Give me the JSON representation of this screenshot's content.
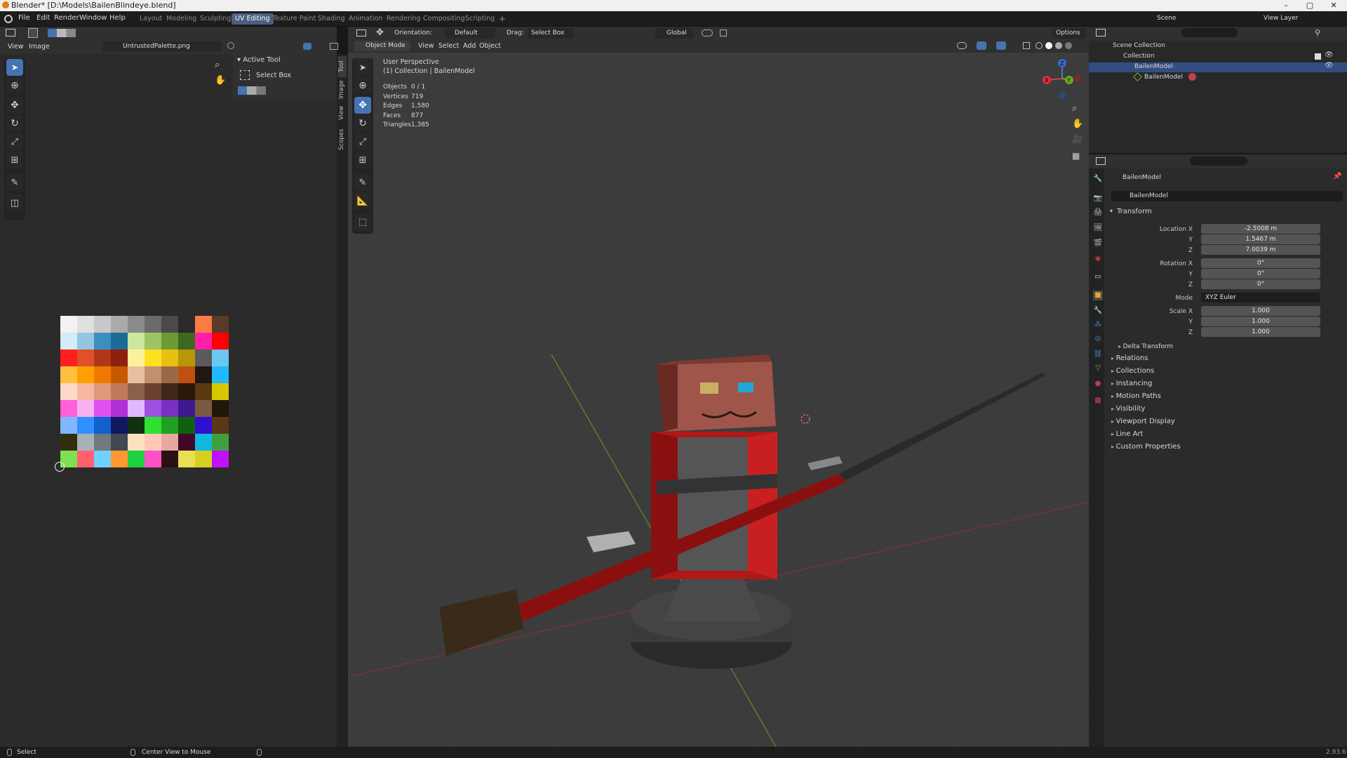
{
  "window": {
    "title": "Blender* [D:\\Models\\BailenBlindeye.blend]",
    "minimize": "–",
    "maximize": "▢",
    "close": "✕"
  },
  "menu": [
    "File",
    "Edit",
    "Render",
    "Window",
    "Help"
  ],
  "workspaces": [
    "Layout",
    "Modeling",
    "Sculpting",
    "UV Editing",
    "Texture Paint",
    "Shading",
    "Animation",
    "Rendering",
    "Compositing",
    "Scripting"
  ],
  "workspace_add": "+",
  "active_workspace": "UV Editing",
  "scene": {
    "label": "Scene",
    "view_layer": "View Layer"
  },
  "image_editor": {
    "menu_view": "View",
    "menu_image": "Image",
    "image_name": "UntrustedPalette.png",
    "tabs": [
      "Tool",
      "Image",
      "View",
      "Scopes"
    ],
    "active_tool_header": "Active Tool",
    "active_tool": "Select Box"
  },
  "palette": [
    "#f2f2f2",
    "#e0e0e0",
    "#c8c8c8",
    "#aaaaaa",
    "#8a8a8a",
    "#6a6a6a",
    "#4a4a4a",
    "#2a2a2a",
    "#ff7b45",
    "#5a3a2a",
    "#d2ecf8",
    "#94c6e0",
    "#3a8fbf",
    "#1e6a96",
    "#cde6a0",
    "#9cc466",
    "#6e9a36",
    "#3d6820",
    "#ff1fa8",
    "#ff0000",
    "#ff1f1f",
    "#e0502a",
    "#b03818",
    "#8e2010",
    "#fff19a",
    "#ffe020",
    "#e8c010",
    "#b8960a",
    "#5a5a5a",
    "#6cc8f0",
    "#ffc040",
    "#ffa000",
    "#f07800",
    "#c85800",
    "#e8c0a0",
    "#c09070",
    "#9a6a48",
    "#c05010",
    "#201810",
    "#20b8ff",
    "#ffd8c8",
    "#f8b8a0",
    "#e09878",
    "#c07a5a",
    "#8a6048",
    "#6a4030",
    "#402818",
    "#2a1808",
    "#5a3a10",
    "#d8c800",
    "#ff60d8",
    "#f8b0f0",
    "#e050f0",
    "#b030d8",
    "#e0b8ff",
    "#a050e0",
    "#7a30c0",
    "#401890",
    "#7a5a40",
    "#201808",
    "#80b8ff",
    "#3090ff",
    "#1060d0",
    "#101860",
    "#103010",
    "#30e030",
    "#20a020",
    "#106010",
    "#3010d0",
    "#5a3818",
    "#303010",
    "#a8b0b8",
    "#707880",
    "#404850",
    "#ffe0c0",
    "#ffc8b8",
    "#e8a8a0",
    "#400828",
    "#10b8e0",
    "#40a040",
    "#80e050",
    "#ff6070",
    "#70d0ff",
    "#ff9830",
    "#20d040",
    "#ff50c8",
    "#2a1010",
    "#e8e050",
    "#d8d020",
    "#c010ff"
  ],
  "viewport": {
    "mode": "Object Mode",
    "menus": [
      "View",
      "Select",
      "Add",
      "Object"
    ],
    "orientation_label": "Orientation:",
    "orientation": "Default",
    "drag_label": "Drag:",
    "drag": "Select Box",
    "transform": "Global",
    "options": "Options",
    "perspective": "User Perspective",
    "collection_line": "(1) Collection | BailenModel",
    "stats": [
      {
        "k": "Objects",
        "v": "0 / 1"
      },
      {
        "k": "Vertices",
        "v": "719"
      },
      {
        "k": "Edges",
        "v": "1,580"
      },
      {
        "k": "Faces",
        "v": "877"
      },
      {
        "k": "Triangles",
        "v": "1,385"
      }
    ],
    "gizmo": {
      "x": "X",
      "y": "Y",
      "z": "Z"
    }
  },
  "outliner": {
    "scene_collection": "Scene Collection",
    "collection": "Collection",
    "object": "BailenModel",
    "mesh": "BailenModel"
  },
  "properties": {
    "object_name": "BailenModel",
    "datablock": "BailenModel",
    "transform": "Transform",
    "location": {
      "label": "Location X",
      "x": "-2.5008 m",
      "y": "1.5467 m",
      "z": "7.0039 m"
    },
    "rotation": {
      "label": "Rotation X",
      "x": "0°",
      "y": "0°",
      "z": "0°"
    },
    "axis_y": "Y",
    "axis_z": "Z",
    "mode_label": "Mode",
    "mode": "XYZ Euler",
    "scale": {
      "label": "Scale X",
      "x": "1.000",
      "y": "1.000",
      "z": "1.000"
    },
    "delta": "Delta Transform",
    "sections": [
      "Relations",
      "Collections",
      "Instancing",
      "Motion Paths",
      "Visibility",
      "Viewport Display",
      "Line Art",
      "Custom Properties"
    ]
  },
  "status": {
    "select": "Select",
    "center": "Center View to Mouse",
    "version": "2.93.6"
  }
}
